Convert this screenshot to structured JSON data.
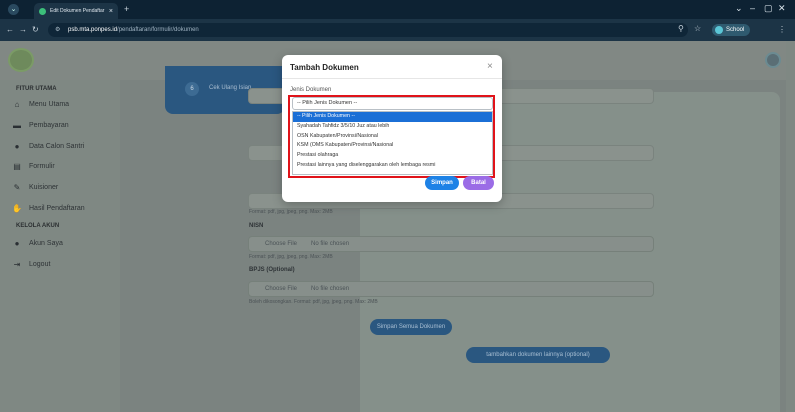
{
  "browser": {
    "tab_title": "Edit Dokumen Pendaftar",
    "new_tab": "+",
    "url_host": "psb.mta.ponpes.id",
    "url_path": "/pendaftaran/formulir/dokumen",
    "profile_label": "School",
    "window_controls": [
      "⌄",
      "–",
      "▢",
      "✕"
    ]
  },
  "sidebar": {
    "section_main": "FITUR UTAMA",
    "items_main": [
      {
        "icon": "home-icon",
        "label": "Menu Utama"
      },
      {
        "icon": "card-icon",
        "label": "Pembayaran"
      },
      {
        "icon": "user-icon",
        "label": "Data Calon Santri"
      },
      {
        "icon": "form-icon",
        "label": "Formulir"
      },
      {
        "icon": "chat-icon",
        "label": "Kuisioner"
      },
      {
        "icon": "handshake-icon",
        "label": "Hasil Pendaftaran"
      }
    ],
    "section_account": "KELOLA AKUN",
    "items_account": [
      {
        "icon": "user-gear-icon",
        "label": "Akun Saya"
      },
      {
        "icon": "logout-icon",
        "label": "Logout"
      }
    ]
  },
  "step": {
    "number": "6",
    "label": "Cek Ulang Isian"
  },
  "form": {
    "hint_1": "Format: pdf, jpg, jpeg, png. Max: 2MB",
    "label_nisn": "NISN",
    "choose_file": "Choose File",
    "no_file": "No file chosen",
    "hint_2": "Format: pdf, jpg, jpeg, png. Max: 2MB",
    "label_bpjs": "BPJS (Optional)",
    "hint_3": "Boleh dikosongkan. Format: pdf, jpg, jpeg, png. Max: 2MB",
    "save_all": "Simpan Semua Dokumen",
    "add_other": "tambahkan dokumen lainnya (optional)"
  },
  "modal": {
    "title": "Tambah Dokumen",
    "close": "×",
    "field_label": "Jenis Dokumen",
    "select_value": "-- Pilih Jenis Dokumen --",
    "options": [
      "-- Pilih Jenis Dokumen --",
      "Syahadah Tahfidz 3/5/10 Juz atau lebih",
      "OSN Kabupaten/Provinsi/Nasional",
      "KSM (OMS Kabupaten/Provinsi/Nasional",
      "Prestasi olahraga",
      "Prestasi lainnya yang diselenggarakan oleh lembaga resmi"
    ],
    "save": "Simpan",
    "cancel": "Batal"
  },
  "colors": {
    "highlight": "#e0131a",
    "primary": "#1d82e6",
    "secondary": "#9b6ce6",
    "selected_option": "#1b6fd6"
  }
}
